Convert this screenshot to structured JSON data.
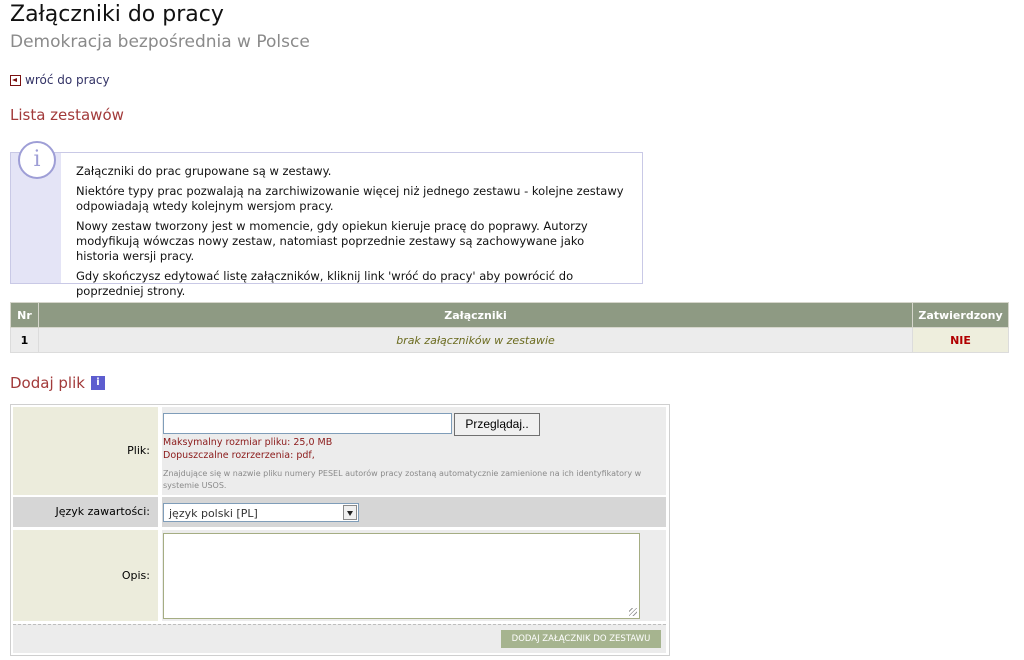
{
  "header": {
    "title": "Załączniki do pracy",
    "subtitle": "Demokracja bezpośrednia w Polsce"
  },
  "nav": {
    "back_label": "wróć do pracy"
  },
  "sections": {
    "list_title": "Lista zestawów",
    "add_title": "Dodaj plik"
  },
  "info": {
    "icon": "info-icon",
    "paragraphs": [
      "Załączniki do prac grupowane są w zestawy.",
      "Niektóre typy prac pozwalają na zarchiwizowanie więcej niż jednego zestawu - kolejne zestawy odpowiadają wtedy kolejnym wersjom pracy.",
      "Nowy zestaw tworzony jest w momencie, gdy opiekun kieruje pracę do poprawy. Autorzy modyfikują wówczas nowy zestaw, natomiast poprzednie zestawy są zachowywane jako historia wersji pracy.",
      "Gdy skończysz edytować listę załączników, kliknij link 'wróć do pracy' aby powrócić do poprzedniej strony."
    ]
  },
  "table": {
    "columns": [
      "Nr",
      "Załączniki",
      "Zatwierdzony"
    ],
    "rows": [
      {
        "nr": "1",
        "attachments": "brak załączników w zestawie",
        "approved": "NIE"
      }
    ]
  },
  "form": {
    "file_label": "Plik:",
    "browse_label": "Przeglądaj..",
    "max_size": "Maksymalny rozmiar pliku: 25,0 MB",
    "allowed_ext": "Dopuszczalne rozrzerzenia: pdf,",
    "pesel_note": "Znajdujące się w nazwie pliku numery PESEL autorów pracy zostaną automatycznie zamienione na ich identyfikatory w systemie USOS.",
    "lang_label": "Język zawartości:",
    "lang_value": "język polski [PL]",
    "desc_label": "Opis:",
    "submit_label": "DODAJ ZAŁĄCZNIK DO ZESTAWU"
  },
  "colors": {
    "section_heading": "#a23a3a",
    "table_header": "#8e9a83",
    "status_no": "#b10000",
    "submit_button": "#a6b48f"
  }
}
